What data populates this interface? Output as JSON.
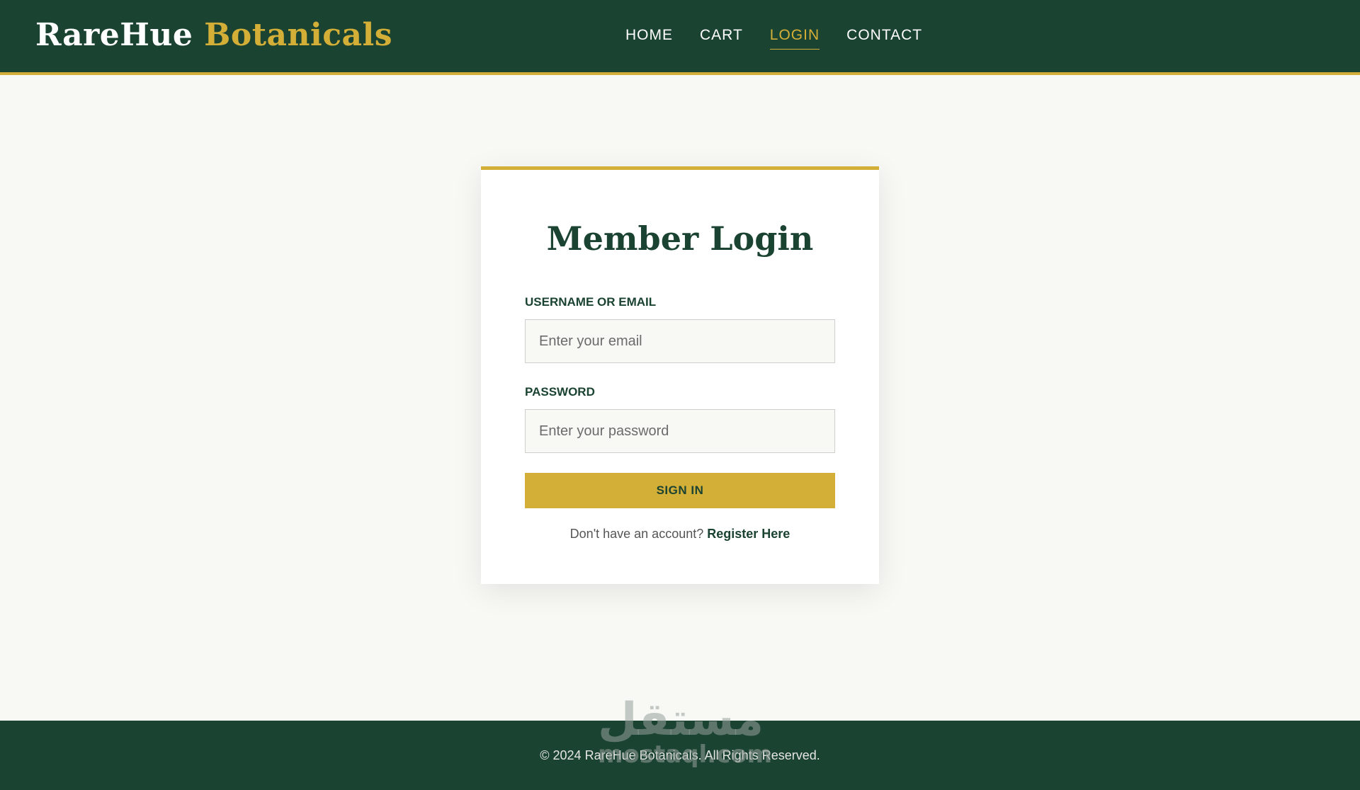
{
  "header": {
    "logo_part1": "RareHue",
    "logo_part2": "Botanicals",
    "nav": [
      {
        "label": "HOME",
        "active": false
      },
      {
        "label": "CART",
        "active": false
      },
      {
        "label": "LOGIN",
        "active": true
      },
      {
        "label": "CONTACT",
        "active": false
      }
    ]
  },
  "login": {
    "title": "Member Login",
    "username_label": "USERNAME OR EMAIL",
    "username_placeholder": "Enter your email",
    "password_label": "PASSWORD",
    "password_placeholder": "Enter your password",
    "submit_label": "SIGN IN",
    "register_prompt": "Don't have an account?",
    "register_link": "Register Here"
  },
  "footer": {
    "copyright": "© 2024 RareHue Botanicals. All Rights Reserved."
  },
  "watermark": {
    "arabic": "مستقل",
    "latin": "mostaql.com"
  },
  "colors": {
    "primary": "#1b4332",
    "accent": "#d4af37",
    "background": "#f8f8f4"
  }
}
